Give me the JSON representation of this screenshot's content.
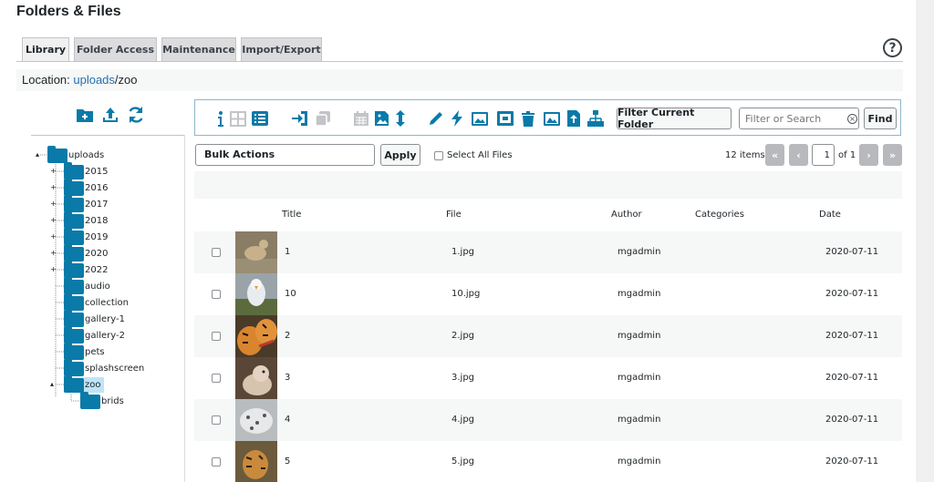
{
  "page": {
    "title": "Folders & Files"
  },
  "tabs": [
    {
      "label": "Library",
      "active": true
    },
    {
      "label": "Folder Access",
      "active": false
    },
    {
      "label": "Maintenance",
      "active": false
    },
    {
      "label": "Import/Export",
      "active": false
    }
  ],
  "help_glyph": "?",
  "location": {
    "prefix": "Location: ",
    "link": "uploads",
    "rest": "/zoo"
  },
  "sidebar": {
    "icons": [
      "add-folder-icon",
      "upload-icon",
      "refresh-icon"
    ],
    "tree": [
      {
        "label": "uploads",
        "level": 0
      },
      {
        "label": "2015",
        "level": 1
      },
      {
        "label": "2016",
        "level": 1
      },
      {
        "label": "2017",
        "level": 1
      },
      {
        "label": "2018",
        "level": 1
      },
      {
        "label": "2019",
        "level": 1
      },
      {
        "label": "2020",
        "level": 1
      },
      {
        "label": "2022",
        "level": 1
      },
      {
        "label": "audio",
        "level": 1
      },
      {
        "label": "collection",
        "level": 1
      },
      {
        "label": "gallery-1",
        "level": 1
      },
      {
        "label": "gallery-2",
        "level": 1
      },
      {
        "label": "pets",
        "level": 1
      },
      {
        "label": "splashscreen",
        "level": 1
      },
      {
        "label": "zoo",
        "level": 1,
        "selected": true
      },
      {
        "label": "brids",
        "level": 2
      }
    ]
  },
  "toolbar": {
    "icons": [
      "info-icon",
      "grid-view-icon",
      "list-view-icon",
      "move-icon",
      "copy-icon",
      "calendar-icon",
      "sort-image-icon",
      "sort-icon",
      "rename-icon",
      "flash-icon",
      "image-edit-icon",
      "image-crop-icon",
      "delete-icon",
      "image-icon",
      "image-upload-icon",
      "sitemap-icon"
    ],
    "filter_label": "Filter Current Folder",
    "search_placeholder": "Filter or Search",
    "find_label": "Find"
  },
  "bulk": {
    "label": "Bulk Actions",
    "apply_label": "Apply",
    "select_all_label": "Select All Files"
  },
  "pagination": {
    "items": "12 items",
    "first": "«",
    "prev": "‹",
    "current": "1",
    "of": "of 1",
    "next": "›",
    "last": "»"
  },
  "table": {
    "headers": {
      "title": "Title",
      "file": "File",
      "author": "Author",
      "categories": "Categories",
      "date": "Date"
    },
    "rows": [
      {
        "title": "1",
        "file": "1.jpg",
        "author": "mgadmin",
        "date": "2020-07-11"
      },
      {
        "title": "10",
        "file": "10.jpg",
        "author": "mgadmin",
        "date": "2020-07-11"
      },
      {
        "title": "2",
        "file": "2.jpg",
        "author": "mgadmin",
        "date": "2020-07-11"
      },
      {
        "title": "3",
        "file": "3.jpg",
        "author": "mgadmin",
        "date": "2020-07-11"
      },
      {
        "title": "4",
        "file": "4.jpg",
        "author": "mgadmin",
        "date": "2020-07-11"
      },
      {
        "title": "5",
        "file": "5.jpg",
        "author": "mgadmin",
        "date": "2020-07-11"
      }
    ]
  },
  "colors": {
    "accent": "#0a7aa8",
    "link": "#2271b1",
    "toolbar_border": "#8cb7cc"
  }
}
